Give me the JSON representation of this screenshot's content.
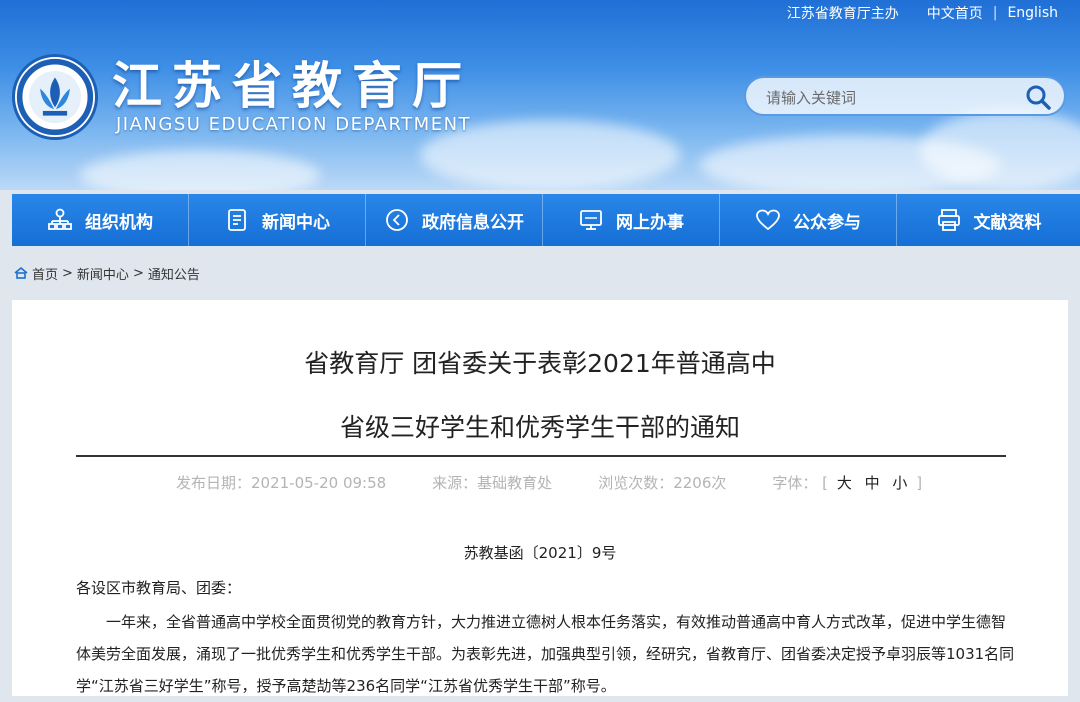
{
  "header": {
    "top_links": [
      "江苏省教育厅主办",
      "中文首页",
      "|",
      "English"
    ],
    "site_title": "江苏省教育厅",
    "site_subtitle": "JIANGSU EDUCATION DEPARTMENT",
    "search_placeholder": "请输入关键词",
    "icons": {
      "logo": "jiangsu-edu-logo",
      "search": "search-icon"
    }
  },
  "nav": {
    "items": [
      {
        "label": "组织机构",
        "icon": "org-chart-icon"
      },
      {
        "label": "新闻中心",
        "icon": "document-icon"
      },
      {
        "label": "政府信息公开",
        "icon": "play-circle-icon"
      },
      {
        "label": "网上办事",
        "icon": "monitor-icon"
      },
      {
        "label": "公众参与",
        "icon": "heart-icon"
      },
      {
        "label": "文献资料",
        "icon": "printer-icon"
      }
    ]
  },
  "breadcrumb": {
    "home": "首页",
    "sep": ">",
    "items": [
      "新闻中心",
      "通知公告"
    ]
  },
  "article": {
    "title_line1": "省教育厅 团省委关于表彰2021年普通高中",
    "title_line2": "省级三好学生和优秀学生干部的通知",
    "meta": {
      "date": "发布日期：2021-05-20 09:58",
      "source": "来源：基础教育处",
      "views": "浏览次数：2206次",
      "font_label": "字体：",
      "font_bracket_open": "[",
      "font_large": "大",
      "font_medium": "中",
      "font_small": "小",
      "font_bracket_close": "]"
    },
    "doc_no": "苏教基函〔2021〕9号",
    "salutation": "各设区市教育局、团委：",
    "body": "一年来，全省普通高中学校全面贯彻党的教育方针，大力推进立德树人根本任务落实，有效推动普通高中育人方式改革，促进中学生德智体美劳全面发展，涌现了一批优秀学生和优秀学生干部。为表彰先进，加强典型引领，经研究，省教育厅、团省委决定授予卓羽辰等1031名同学“江苏省三好学生”称号，授予高楚劼等236名同学“江苏省优秀学生干部”称号。"
  },
  "colors": {
    "nav_bg": "#156fd6",
    "header_top": "#1f6fd6",
    "content_bg": "#ffffff"
  }
}
